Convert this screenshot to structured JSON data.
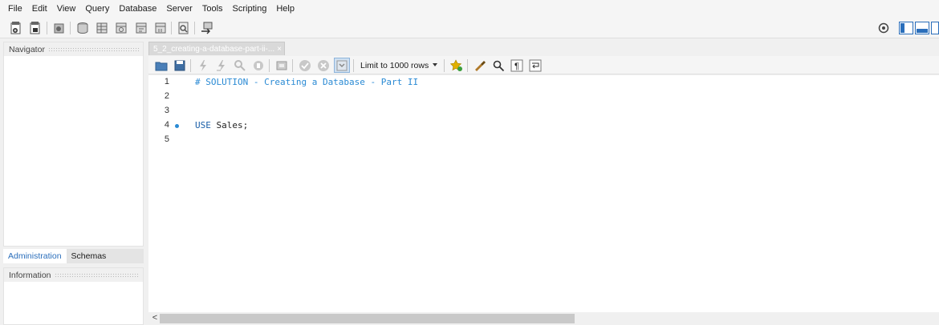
{
  "menu": [
    "File",
    "Edit",
    "View",
    "Query",
    "Database",
    "Server",
    "Tools",
    "Scripting",
    "Help"
  ],
  "toolbar_icons": [
    "new-sql-tab-icon",
    "open-sql-script-icon",
    "open-inspector-icon",
    "create-schema-icon",
    "create-table-icon",
    "create-view-icon",
    "create-procedure-icon",
    "create-function-icon",
    "search-table-data-icon",
    "reconnect-icon"
  ],
  "right_icons": [
    "settings-icon",
    "toggle-sidebar-icon",
    "toggle-output-icon",
    "toggle-secondary-sidebar-icon"
  ],
  "navigator": {
    "title": "Navigator"
  },
  "nav_tabs": [
    "Administration",
    "Schemas"
  ],
  "information": {
    "title": "Information"
  },
  "doc_tab": {
    "label": "5_2_creating-a-database-part-ii-...",
    "close": "×"
  },
  "editor_toolbar": {
    "limit_label": "Limit to 1000 rows",
    "icons": [
      "open-file-icon",
      "save-icon",
      "execute-icon",
      "execute-current-icon",
      "explain-icon",
      "stop-icon",
      "toggle-error-icon",
      "commit-icon",
      "rollback-icon",
      "autocommit-icon",
      "beautify-icon",
      "find-icon",
      "invisible-chars-icon",
      "wrap-icon"
    ]
  },
  "editor": {
    "lines": [
      {
        "number": "1",
        "text": "# SOLUTION - Creating a Database - Part II",
        "kind": "comment"
      },
      {
        "number": "2",
        "text": "",
        "kind": "plain"
      },
      {
        "number": "3",
        "text": "",
        "kind": "plain"
      },
      {
        "number": "4",
        "keyword": "USE",
        "rest": " Sales;",
        "kind": "statement",
        "marker": true
      },
      {
        "number": "5",
        "text": "",
        "kind": "plain"
      }
    ]
  },
  "colors": {
    "accent": "#2a8ad4",
    "keyword": "#1a5fa8",
    "tab_active": "#2a6ebb"
  }
}
